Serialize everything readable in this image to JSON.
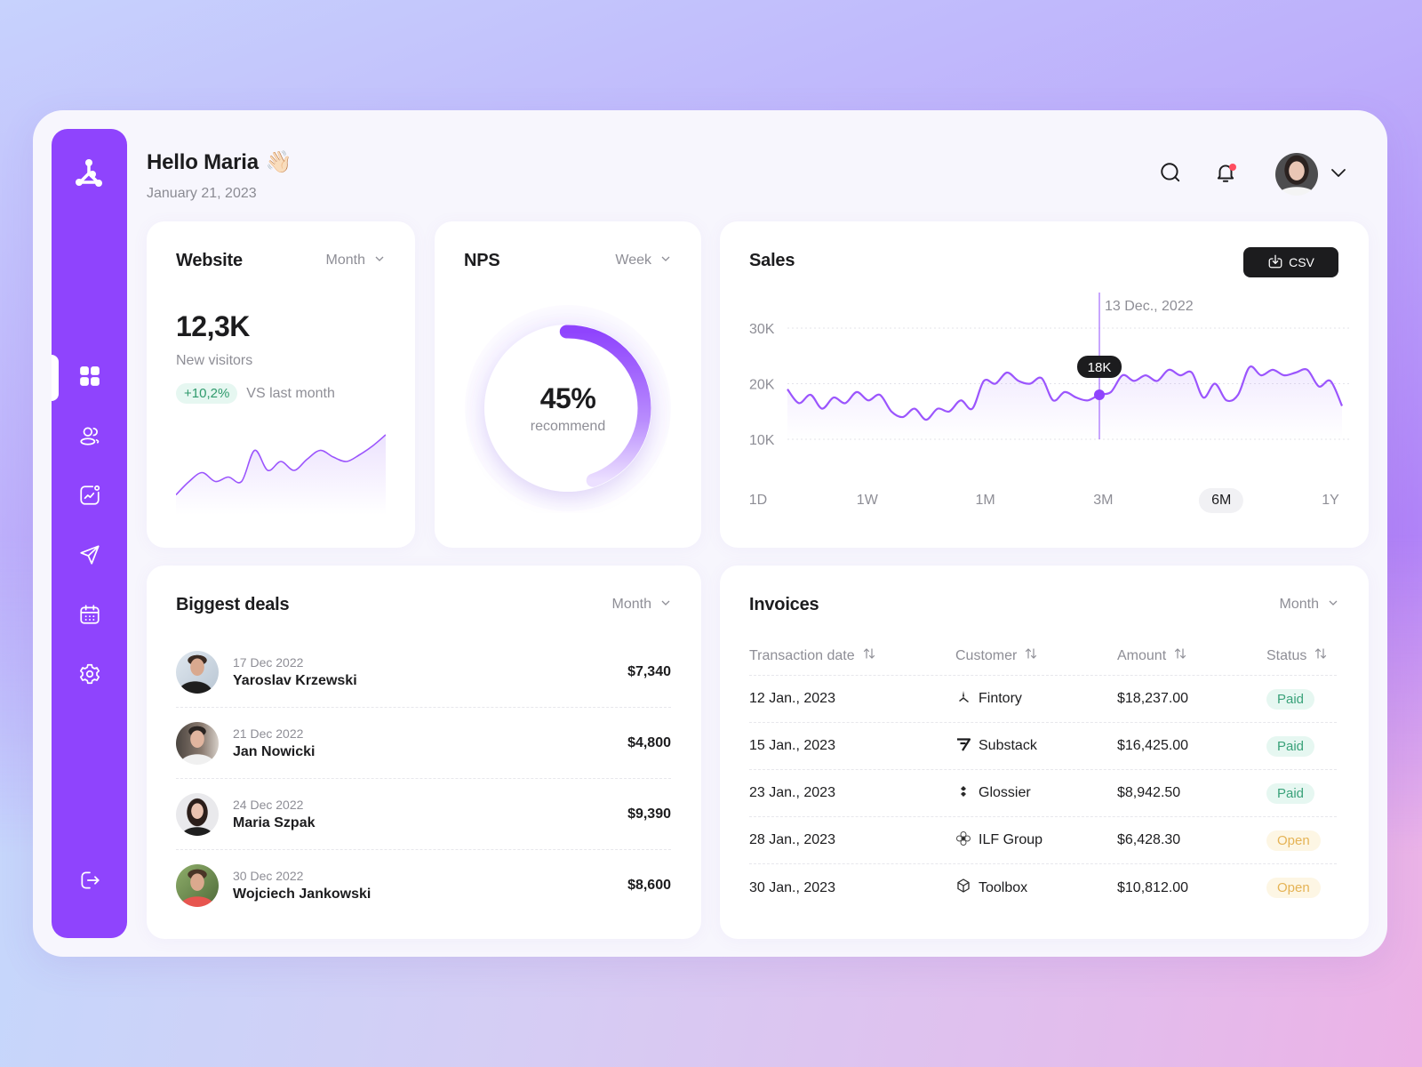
{
  "colors": {
    "accent": "#8f44fd",
    "ink": "#1c1c1e",
    "muted": "#8e8e96",
    "paid_bg": "#e6f7f1",
    "paid_fg": "#3aa27a",
    "open_bg": "#fdf6e4",
    "open_fg": "#e5b355",
    "notification": "#ff4d5f"
  },
  "sidebar": {
    "logo": "network-logo-icon",
    "items": [
      {
        "icon": "dashboard-grid-icon",
        "label": "Dashboard",
        "active": true
      },
      {
        "icon": "users-icon",
        "label": "Users",
        "active": false
      },
      {
        "icon": "analytics-icon",
        "label": "Analytics",
        "active": false
      },
      {
        "icon": "send-icon",
        "label": "Messages",
        "active": false
      },
      {
        "icon": "calendar-icon",
        "label": "Calendar",
        "active": false
      },
      {
        "icon": "settings-gear-icon",
        "label": "Settings",
        "active": false
      }
    ],
    "logout_icon": "logout-icon"
  },
  "header": {
    "greeting": "Hello Maria",
    "wave_emoji": "👋🏻",
    "date": "January 21, 2023",
    "search_icon": "search-icon",
    "notification_icon": "bell-icon",
    "has_notification": true,
    "user_menu_icon": "chevron-down-icon"
  },
  "website": {
    "title": "Website",
    "period": "Month",
    "value": "12,3K",
    "value_label": "New visitors",
    "delta": "+10,2%",
    "delta_label": "VS last month",
    "sparkline": [
      18,
      30,
      38,
      30,
      34,
      30,
      58,
      40,
      48,
      40,
      50,
      58,
      52,
      48,
      54,
      62,
      72
    ]
  },
  "nps": {
    "title": "NPS",
    "period": "Week",
    "value_text": "45%",
    "value": 0.45,
    "label": "recommend"
  },
  "sales": {
    "title": "Sales",
    "csv_label": "CSV",
    "tooltip_date": "13 Dec., 2022",
    "tooltip_value": "18K",
    "ranges": [
      "1D",
      "1W",
      "1M",
      "3M",
      "6M",
      "1Y"
    ],
    "active_range": "6M"
  },
  "chart_data": {
    "type": "area",
    "title": "Sales",
    "xlabel": "",
    "ylabel": "",
    "y_ticks": [
      "30K",
      "20K",
      "10K"
    ],
    "ylim": [
      10000,
      30000
    ],
    "grid": true,
    "highlight": {
      "date": "13 Dec., 2022",
      "value": 18000,
      "label": "18K",
      "index": 27
    },
    "values": [
      19000,
      16500,
      18000,
      15500,
      17500,
      16500,
      18500,
      17000,
      18000,
      15000,
      14000,
      15500,
      13500,
      15500,
      15000,
      17000,
      15500,
      20500,
      20000,
      22000,
      20500,
      20000,
      21000,
      17000,
      18500,
      17500,
      17000,
      18000,
      18500,
      21500,
      20500,
      21500,
      20500,
      22500,
      21500,
      22000,
      17500,
      20000,
      17000,
      18000,
      23000,
      21500,
      22500,
      21500,
      22000,
      22500,
      19500,
      20500,
      16000
    ]
  },
  "deals": {
    "title": "Biggest deals",
    "period": "Month",
    "items": [
      {
        "date": "17 Dec 2022",
        "name": "Yaroslav Krzewski",
        "amount": "$7,340"
      },
      {
        "date": "21 Dec 2022",
        "name": "Jan Nowicki",
        "amount": "$4,800"
      },
      {
        "date": "24 Dec 2022",
        "name": "Maria Szpak",
        "amount": "$9,390"
      },
      {
        "date": "30 Dec 2022",
        "name": "Wojciech Jankowski",
        "amount": "$8,600"
      }
    ]
  },
  "invoices": {
    "title": "Invoices",
    "period": "Month",
    "columns": [
      "Transaction date",
      "Customer",
      "Amount",
      "Status"
    ],
    "rows": [
      {
        "date": "12 Jan., 2023",
        "customer": "Fintory",
        "customer_icon": "fintory-logo-icon",
        "amount": "$18,237.00",
        "status": "Paid"
      },
      {
        "date": "15 Jan., 2023",
        "customer": "Substack",
        "customer_icon": "substack-logo-icon",
        "amount": "$16,425.00",
        "status": "Paid"
      },
      {
        "date": "23 Jan., 2023",
        "customer": "Glossier",
        "customer_icon": "glossier-logo-icon",
        "amount": "$8,942.50",
        "status": "Paid"
      },
      {
        "date": "28 Jan., 2023",
        "customer": "ILF Group",
        "customer_icon": "ilf-group-logo-icon",
        "amount": "$6,428.30",
        "status": "Open"
      },
      {
        "date": "30 Jan., 2023",
        "customer": "Toolbox",
        "customer_icon": "toolbox-logo-icon",
        "amount": "$10,812.00",
        "status": "Open"
      }
    ]
  }
}
